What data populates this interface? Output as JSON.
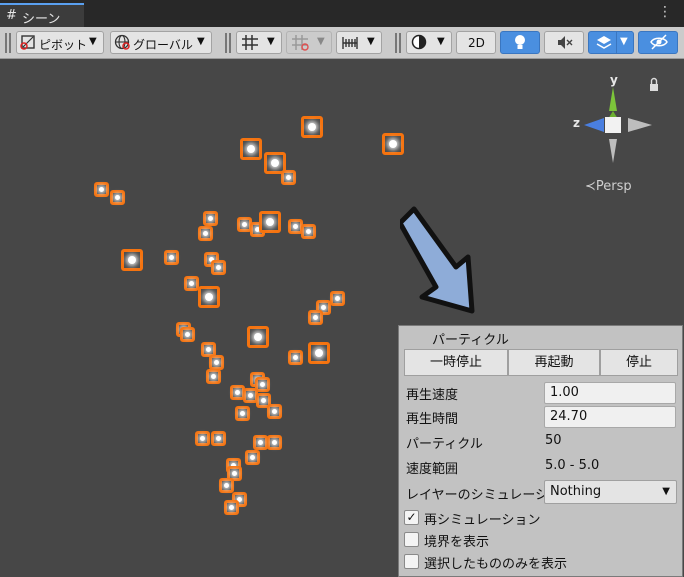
{
  "tab": {
    "icon": "#",
    "title": "シーン",
    "menu": "⋮"
  },
  "toolbar": {
    "pivot_label": "ピボット",
    "global_label": "グローバル",
    "view_2d": "2D"
  },
  "gizmo": {
    "y_label": "y",
    "z_label": "z",
    "persp_label": "≺Persp"
  },
  "panel": {
    "title": "パーティクル",
    "pause_button": "一時停止",
    "restart_button": "再起動",
    "stop_button": "停止",
    "playback_speed_label": "再生速度",
    "playback_speed_value": "1.00",
    "playback_time_label": "再生時間",
    "playback_time_value": "24.70",
    "particles_label": "パーティクル",
    "particles_value": "50",
    "speed_range_label": "速度範囲",
    "speed_range_value": "5.0 - 5.0",
    "simulate_layers_label": "レイヤーのシミュレーショ",
    "simulate_layers_value": "Nothing",
    "resimulate_label": "再シミュレーション",
    "resimulate_checked": "✓",
    "show_bounds_label": "境界を表示",
    "show_selected_only_label": "選択したもののみを表示"
  },
  "colors": {
    "accent": "#4a8fe0",
    "particle_outline": "#f5730f",
    "arrow_fill": "#8eacd8"
  }
}
